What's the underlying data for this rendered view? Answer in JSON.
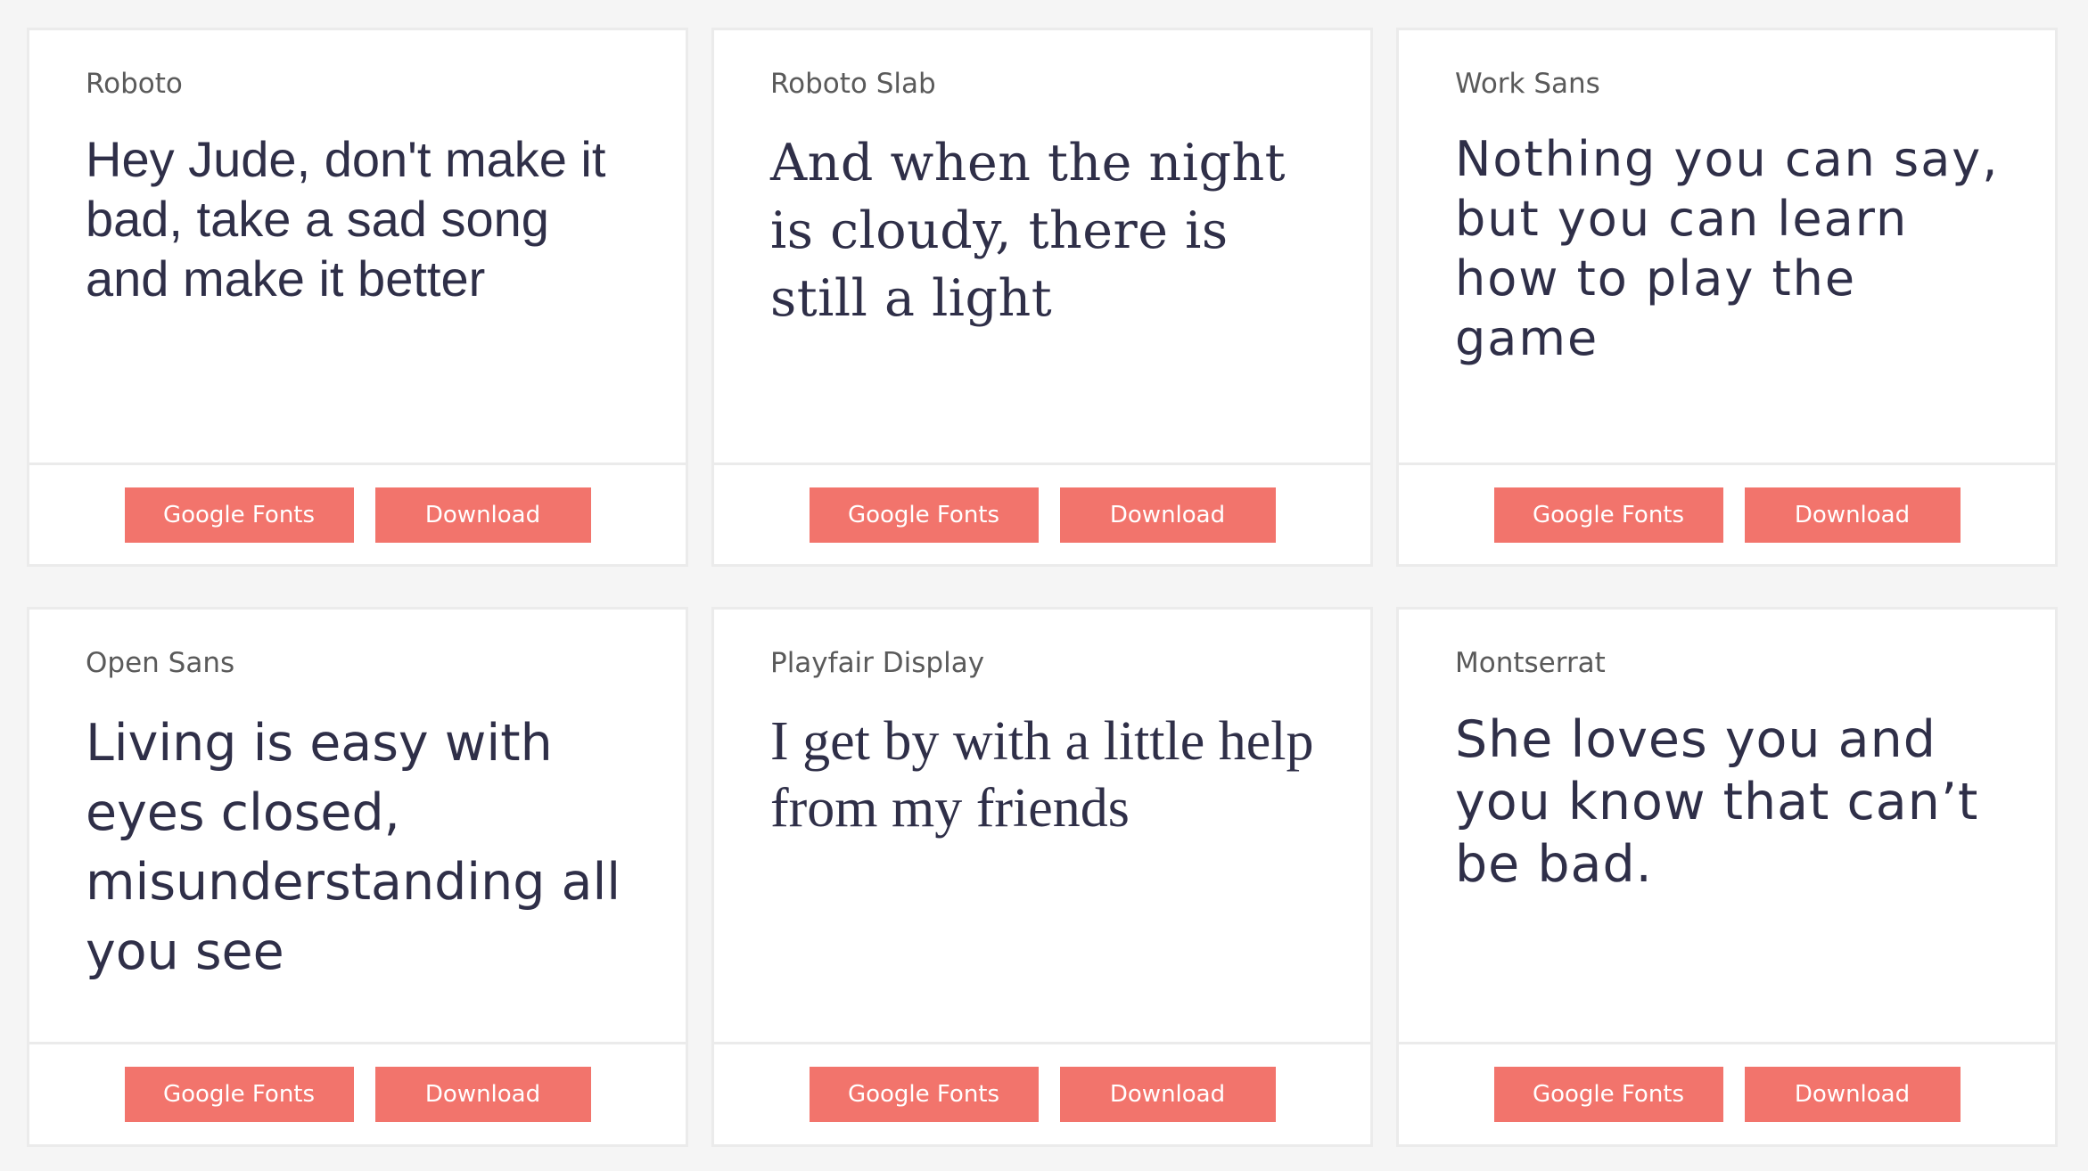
{
  "cards": [
    {
      "font_name": "Roboto",
      "sample": "Hey Jude, don't make it bad, take a sad song and make it better",
      "google_fonts_label": "Google Fonts",
      "download_label": "Download"
    },
    {
      "font_name": "Roboto Slab",
      "sample": "And when the night is cloudy, there is still a light",
      "google_fonts_label": "Google Fonts",
      "download_label": "Download"
    },
    {
      "font_name": "Work Sans",
      "sample": "Nothing you can say, but you can learn how to play the game",
      "google_fonts_label": "Google Fonts",
      "download_label": "Download"
    },
    {
      "font_name": "Open Sans",
      "sample": "Living is easy with eyes closed, misunderstanding all you see",
      "google_fonts_label": "Google Fonts",
      "download_label": "Download"
    },
    {
      "font_name": "Playfair Display",
      "sample": "I get by with a little help from my friends",
      "google_fonts_label": "Google Fonts",
      "download_label": "Download"
    },
    {
      "font_name": "Montserrat",
      "sample": "She loves you and you know that can’t be bad.",
      "google_fonts_label": "Google Fonts",
      "download_label": "Download"
    }
  ],
  "colors": {
    "page_background": "#f5f5f5",
    "card_background": "#ffffff",
    "card_border": "#ebebeb",
    "button": "#f2746c",
    "button_text": "#ffffff",
    "sample_text": "#2f2f48",
    "font_name_text": "#5a5a5a"
  }
}
